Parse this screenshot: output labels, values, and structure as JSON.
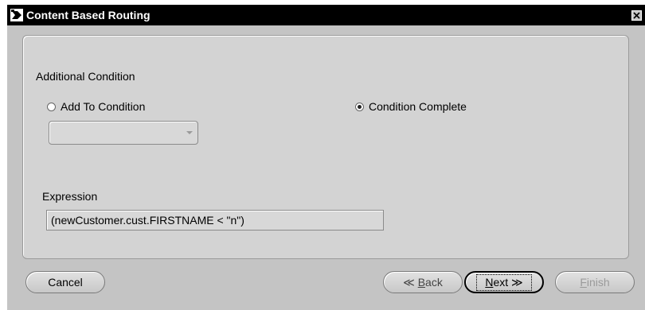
{
  "window": {
    "title": "Content Based Routing"
  },
  "condition": {
    "section_label": "Additional Condition",
    "add_to_condition_label": "Add To Condition",
    "condition_complete_label": "Condition Complete",
    "selected_option": "Condition Complete",
    "condition_select_value": ""
  },
  "expression": {
    "label": "Expression",
    "value": "(newCustomer.cust.FIRSTNAME < \"n\")"
  },
  "buttons": {
    "cancel": "Cancel",
    "back_arrow": "≪",
    "back_mnemonic": "B",
    "back_rest": "ack",
    "next_mnemonic": "N",
    "next_rest": "ext",
    "next_arrow": "≫",
    "finish_mnemonic": "F",
    "finish_rest": "inish"
  },
  "icons": {
    "app": "app-window-icon",
    "close": "close-icon"
  }
}
